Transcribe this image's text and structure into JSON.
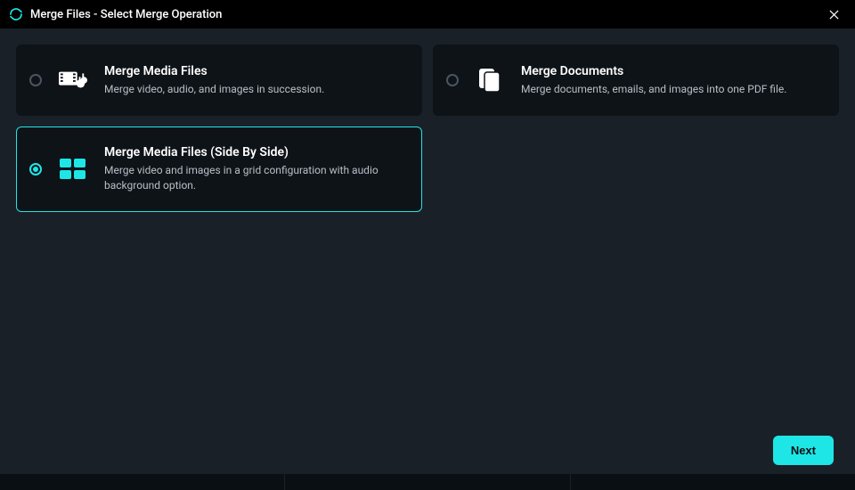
{
  "window": {
    "title": "Merge Files - Select Merge Operation"
  },
  "options": {
    "media": {
      "title": "Merge Media Files",
      "desc": "Merge video, audio, and images in succession.",
      "selected": false
    },
    "documents": {
      "title": "Merge Documents",
      "desc": "Merge documents, emails, and images into one PDF file.",
      "selected": false
    },
    "sidebyside": {
      "title": "Merge Media Files (Side By Side)",
      "desc": "Merge video and images in a grid configuration with audio background option.",
      "selected": true
    }
  },
  "buttons": {
    "next": "Next"
  },
  "colors": {
    "accent": "#1ee6e6",
    "bg": "#1a2028",
    "card": "#0e1318"
  }
}
